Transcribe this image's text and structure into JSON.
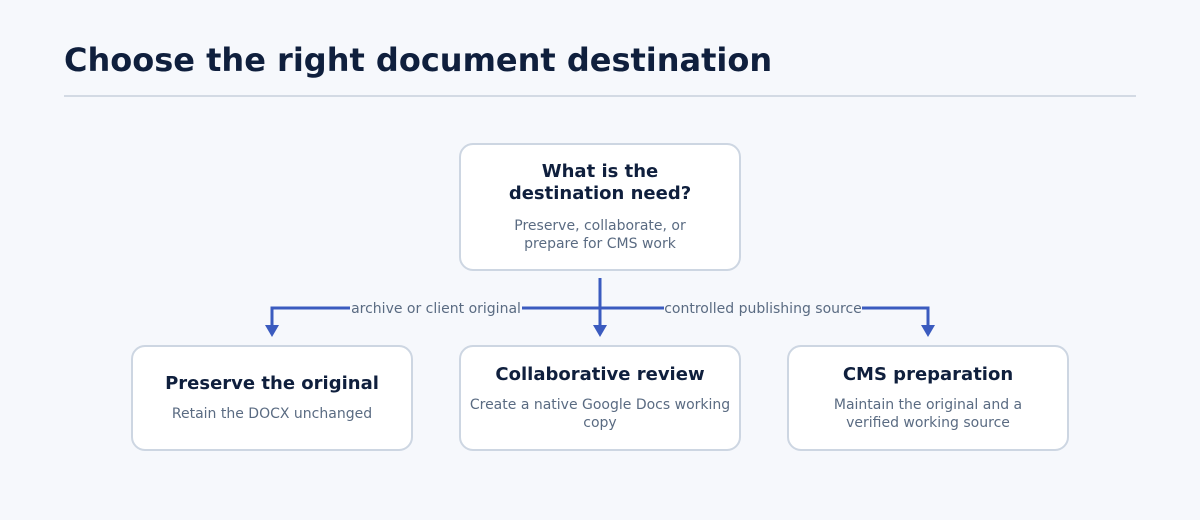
{
  "title": "Choose the right document destination",
  "colors": {
    "background": "#f6f8fc",
    "connector": "#3b5bbf",
    "node_border": "#cdd6e2",
    "heading": "#0f1f3d",
    "muted_text": "#5a6b82"
  },
  "root": {
    "title": "What is the destination need?",
    "description": "Preserve, collaborate, or prepare for CMS work"
  },
  "branches": [
    {
      "edge_label": "archive or client original",
      "title": "Preserve the original",
      "description": "Retain the DOCX unchanged"
    },
    {
      "edge_label": "",
      "title": "Collaborative review",
      "description": "Create a native Google Docs working copy"
    },
    {
      "edge_label": "controlled publishing source",
      "title": "CMS preparation",
      "description": "Maintain the original and a verified working source"
    }
  ]
}
